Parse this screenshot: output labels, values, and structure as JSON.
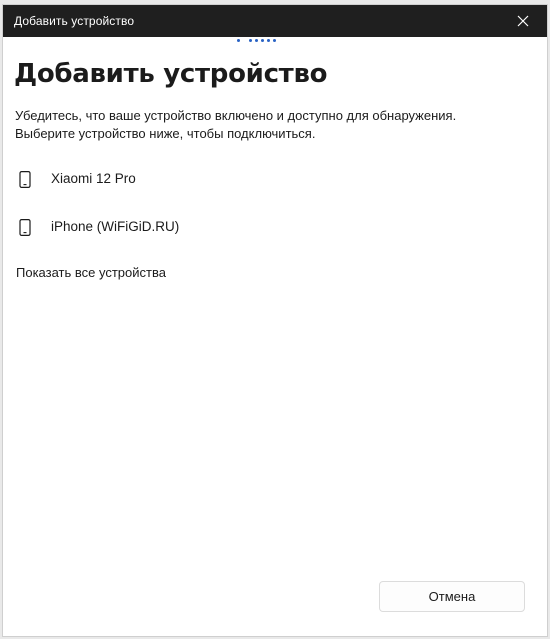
{
  "window": {
    "title": "Добавить устройство",
    "close_icon": "close-icon"
  },
  "content": {
    "heading": "Добавить устройство",
    "description_line1": "Убедитесь, что ваше устройство включено и доступно для обнаружения.",
    "description_line2": "Выберите устройство ниже, чтобы подключиться."
  },
  "devices": [
    {
      "label": "Xiaomi 12 Pro",
      "icon": "phone-icon"
    },
    {
      "label": "iPhone (WiFiGiD.RU)",
      "icon": "phone-icon"
    }
  ],
  "show_all_label": "Показать все устройства",
  "footer": {
    "cancel_label": "Отмена"
  },
  "colors": {
    "titlebar_bg": "#1f1f1f",
    "accent_dots": "#2a63c5",
    "window_bg": "#ffffff"
  }
}
